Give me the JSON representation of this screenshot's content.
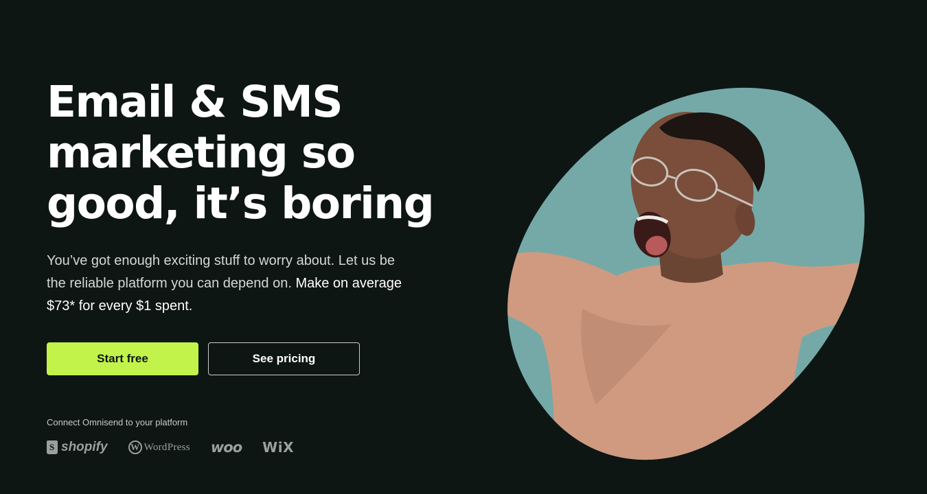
{
  "hero": {
    "title_lines": [
      "Email & SMS",
      "marketing so",
      "good, it’s boring"
    ],
    "subtitle_plain": "You’ve got enough exciting stuff to worry about. Let us be the reliable platform you can depend on. ",
    "subtitle_emphasis": "Make on average $73* for every $1 spent."
  },
  "actions": {
    "primary_label": "Start free",
    "secondary_label": "See pricing"
  },
  "integrations": {
    "label": "Connect Omnisend to your platform",
    "platforms": [
      {
        "name": "shopify",
        "icon": "shopify-bag-icon"
      },
      {
        "name": "WordPress",
        "icon": "wordpress-icon"
      },
      {
        "name": "woo",
        "icon": "woo-logo"
      },
      {
        "name": "WiX",
        "icon": "wix-logo"
      }
    ]
  },
  "colors": {
    "background": "#0e1614",
    "accent": "#c1f34a",
    "photo_backdrop": "#74a9a8",
    "sweater": "#cf9a80"
  }
}
